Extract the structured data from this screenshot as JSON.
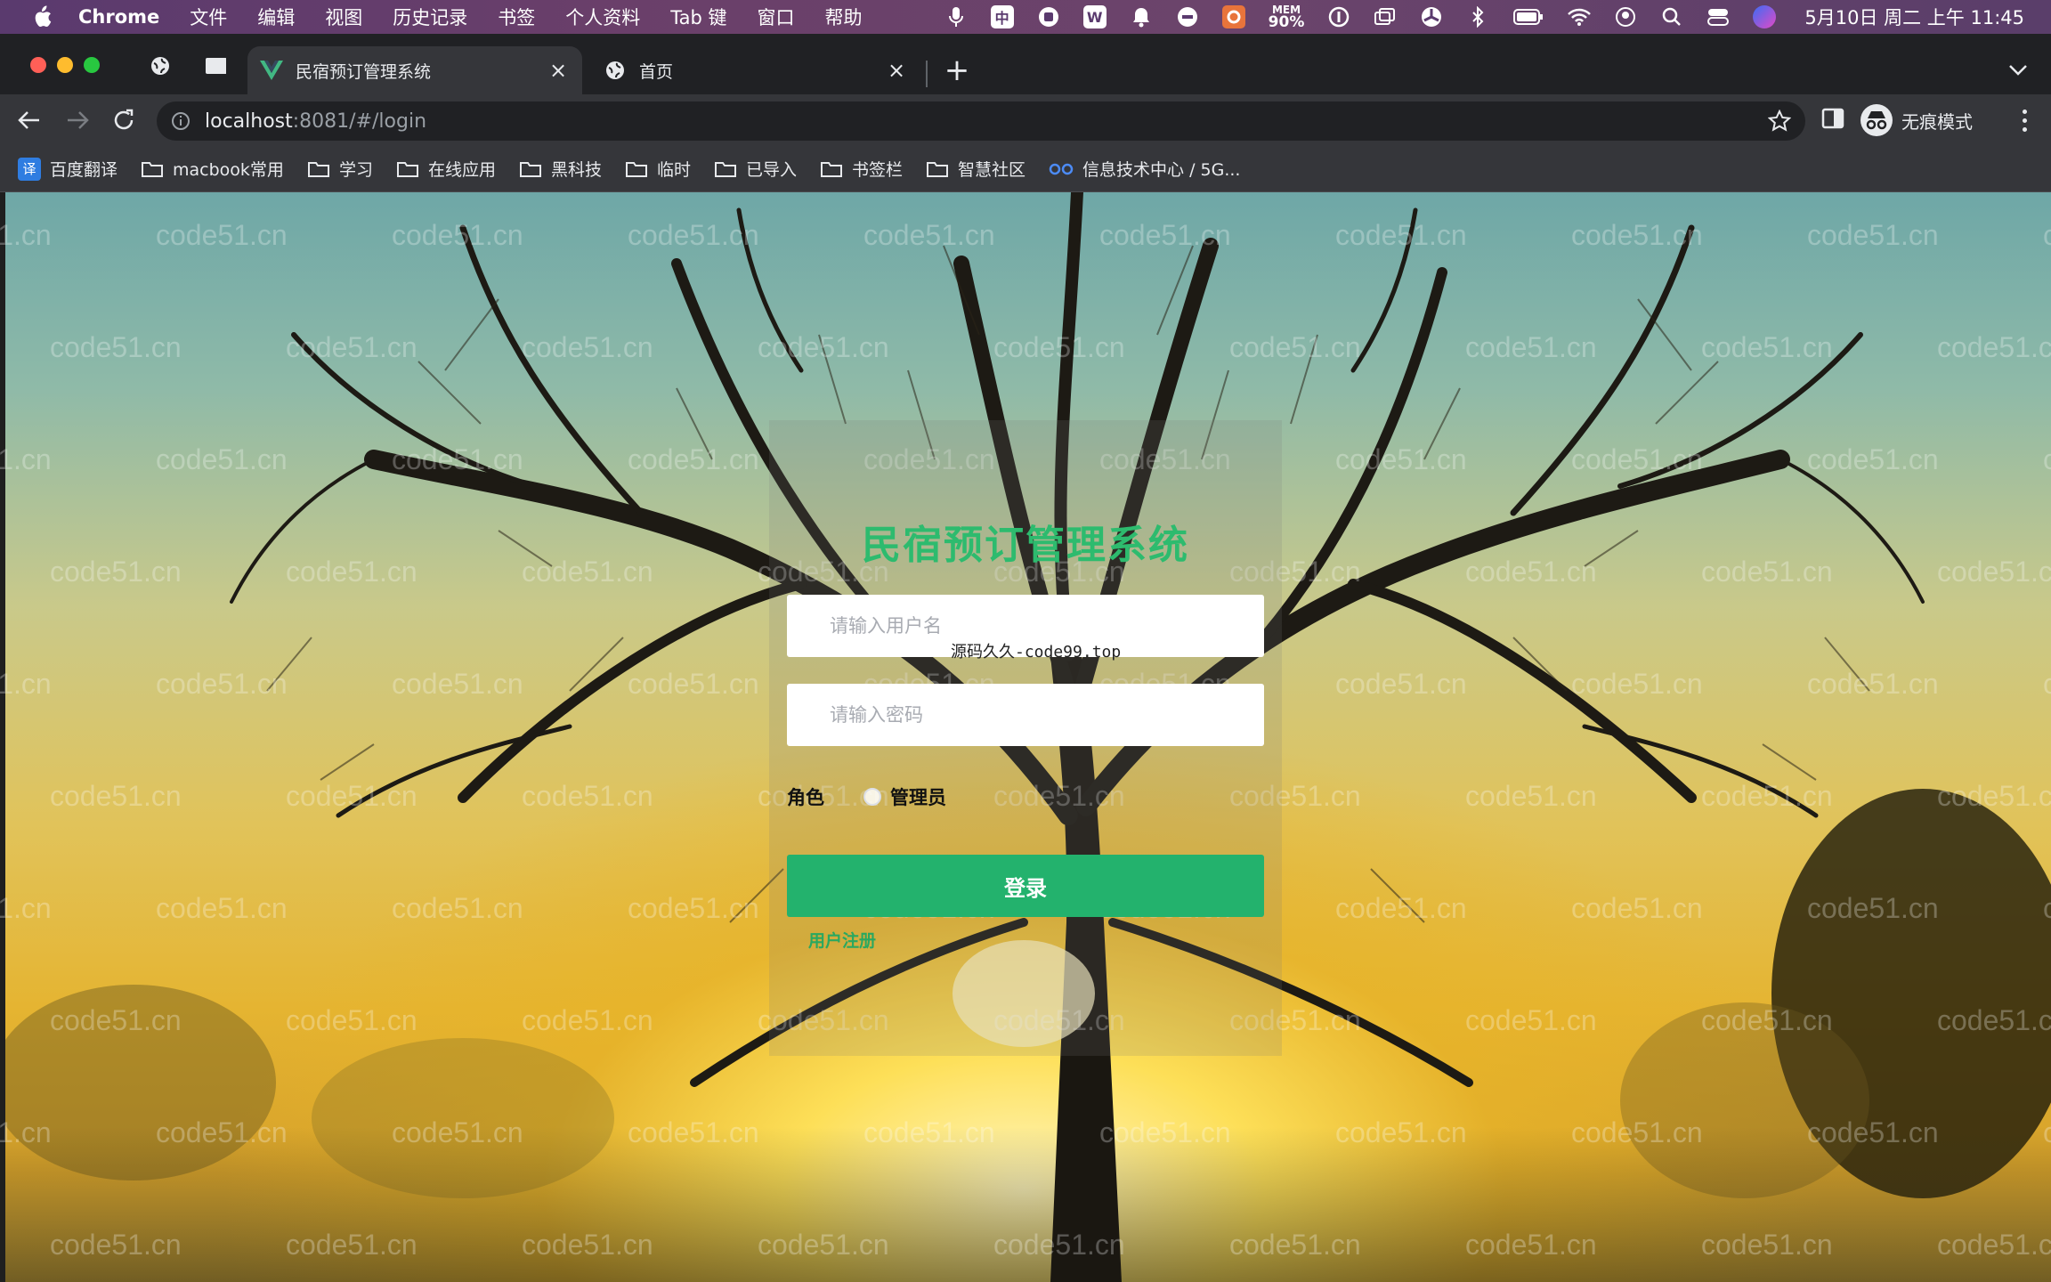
{
  "menubar": {
    "app_name": "Chrome",
    "items": [
      "文件",
      "编辑",
      "视图",
      "历史记录",
      "书签",
      "个人资料",
      "Tab 键",
      "窗口",
      "帮助"
    ],
    "mem_label": "MEM",
    "mem_value": "90%",
    "clock": "5月10日 周二 上午 11:45"
  },
  "tabs": {
    "active_title": "民宿预订管理系统",
    "inactive_title": "首页"
  },
  "toolbar": {
    "url_host": "localhost",
    "url_rest": ":8081/#/login",
    "profile_label": "无痕模式"
  },
  "bookmarks": [
    {
      "label": "百度翻译",
      "icon": "translate-icon"
    },
    {
      "label": "macbook常用",
      "icon": "folder-icon"
    },
    {
      "label": "学习",
      "icon": "folder-icon"
    },
    {
      "label": "在线应用",
      "icon": "folder-icon"
    },
    {
      "label": "黑科技",
      "icon": "folder-icon"
    },
    {
      "label": "临时",
      "icon": "folder-icon"
    },
    {
      "label": "已导入",
      "icon": "folder-icon"
    },
    {
      "label": "书签栏",
      "icon": "folder-icon"
    },
    {
      "label": "智慧社区",
      "icon": "folder-icon"
    },
    {
      "label": "信息技术中心 / 5G...",
      "icon": "link-icon"
    }
  ],
  "login": {
    "title": "民宿预订管理系统",
    "username_placeholder": "请输入用户名",
    "password_placeholder": "请输入密码",
    "role_label": "角色",
    "role_option": "管理员",
    "login_button": "登录",
    "register_link": "用户注册"
  },
  "page_stamp": "源码久久-code99.top",
  "watermark_text": "code51.cn",
  "colors": {
    "accent_green": "#23b26d",
    "title_green": "#2dbb6e"
  }
}
